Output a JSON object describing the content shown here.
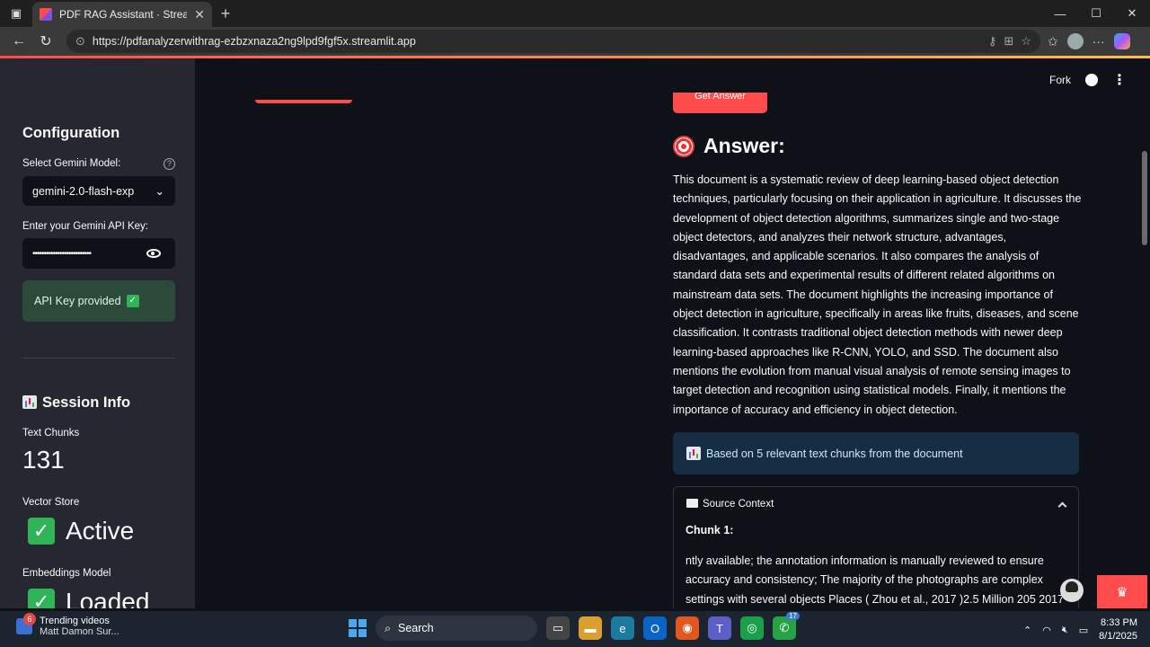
{
  "browser": {
    "tab_title": "PDF RAG Assistant · Streamlit",
    "url": "https://pdfanalyzerwithrag-ezbzxnaza2ng9lpd9fgf5x.streamlit.app"
  },
  "sidebar": {
    "config_heading": "Configuration",
    "model_label": "Select Gemini Model:",
    "model_value": "gemini-2.0-flash-exp",
    "api_key_label": "Enter your Gemini API Key:",
    "api_key_masked": "••••••••••••••••••••••••••",
    "api_status": "API Key provided",
    "session_heading": "Session Info",
    "text_chunks_label": "Text Chunks",
    "text_chunks_value": "131",
    "vector_store_label": "Vector Store",
    "vector_store_value": "Active",
    "embeddings_label": "Embeddings Model",
    "embeddings_value": "Loaded"
  },
  "header": {
    "fork_label": "Fork"
  },
  "main": {
    "get_answer_label": "Get Answer",
    "answer_heading": "Answer:",
    "answer_text": "This document is a systematic review of deep learning-based object detection techniques, particularly focusing on their application in agriculture. It discusses the development of object detection algorithms, summarizes single and two-stage object detectors, and analyzes their network structure, advantages, disadvantages, and applicable scenarios. It also compares the analysis of standard data sets and experimental results of different related algorithms on mainstream data sets. The document highlights the increasing importance of object detection in agriculture, specifically in areas like fruits, diseases, and scene classification. It contrasts traditional object detection methods with newer deep learning-based approaches like R-CNN, YOLO, and SSD. The document also mentions the evolution from manual visual analysis of remote sensing images to target detection and recognition using statistical models. Finally, it mentions the importance of accuracy and efficiency in object detection.",
    "info_text": "Based on 5 relevant text chunks from the document",
    "source_context_label": "Source Context",
    "chunk_heading": "Chunk 1:",
    "chunk_text": "ntly available; the annotation information is manually reviewed to ensure accuracy and consistency; The majority of the photographs are complex settings with several objects Places ( Zhou et al., 2017 )2.5 Million 205 2017"
  },
  "taskbar": {
    "widget_title": "Trending videos",
    "widget_sub": "Matt Damon Sur...",
    "widget_badge": "6",
    "search_label": "Search",
    "whatsapp_badge": "17",
    "time": "8:33 PM",
    "date": "8/1/2025"
  }
}
